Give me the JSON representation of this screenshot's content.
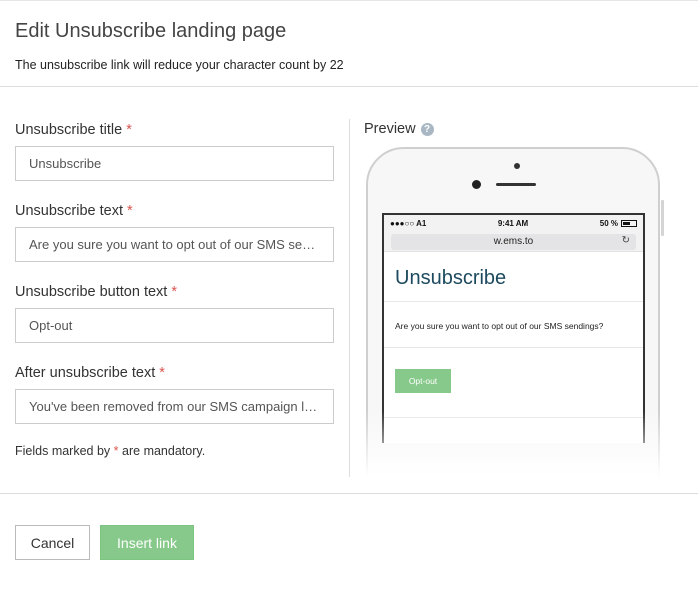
{
  "dialog": {
    "title": "Edit Unsubscribe landing page",
    "subtitle": "The unsubscribe link will reduce your character count by 22"
  },
  "form": {
    "fields": [
      {
        "label": "Unsubscribe title",
        "value": "Unsubscribe"
      },
      {
        "label": "Unsubscribe text",
        "value": "Are you sure you want to opt out of our SMS sendings?"
      },
      {
        "label": "Unsubscribe button text",
        "value": "Opt-out"
      },
      {
        "label": "After unsubscribe text",
        "value": "You've been removed from our SMS campaign list."
      }
    ],
    "required_marker": "*",
    "mandatory_note_before": "Fields marked by",
    "mandatory_note_after": "are mandatory."
  },
  "preview": {
    "label": "Preview",
    "help_icon": "question-circle-icon",
    "status": {
      "carrier": "●●●○○ A1",
      "time": "9:41 AM",
      "battery": "50 %"
    },
    "url": "w.ems.to",
    "page_title": "Unsubscribe",
    "page_text": "Are you sure you want to opt out of our SMS sendings?",
    "page_button": "Opt-out"
  },
  "footer": {
    "cancel_label": "Cancel",
    "insert_label": "Insert link"
  },
  "colors": {
    "accent_green": "#86c98a",
    "required_red": "#d9534f",
    "title_teal": "#1d4a5e"
  }
}
